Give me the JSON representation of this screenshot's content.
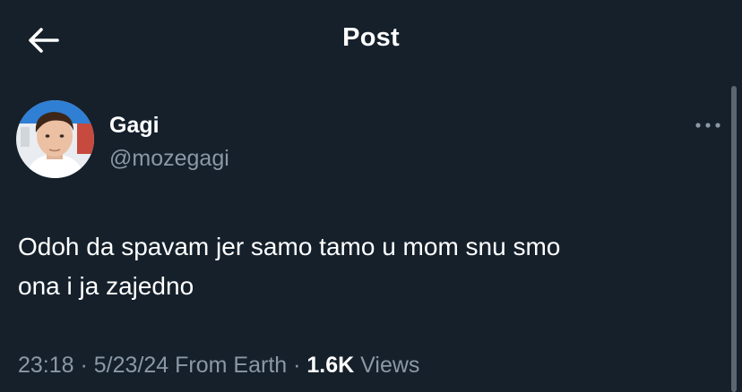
{
  "header": {
    "title": "Post",
    "back_icon": "arrow-left-icon"
  },
  "post": {
    "author": {
      "display_name": "Gagi",
      "handle": "@mozegagi",
      "avatar_icon": "profile-photo"
    },
    "more_icon": "more-horizontal-icon",
    "text_line1": "Odoh da spavam jer samo tamo u mom snu smo",
    "text_line2": "ona i ja zajedno",
    "meta": {
      "time": "23:18",
      "separator": " · ",
      "date": "5/23/24",
      "source": " From Earth",
      "views_count": "1.6K",
      "views_label": " Views"
    }
  },
  "colors": {
    "background": "#15202b",
    "primary_text": "#ffffff",
    "secondary_text": "#8b98a5"
  }
}
